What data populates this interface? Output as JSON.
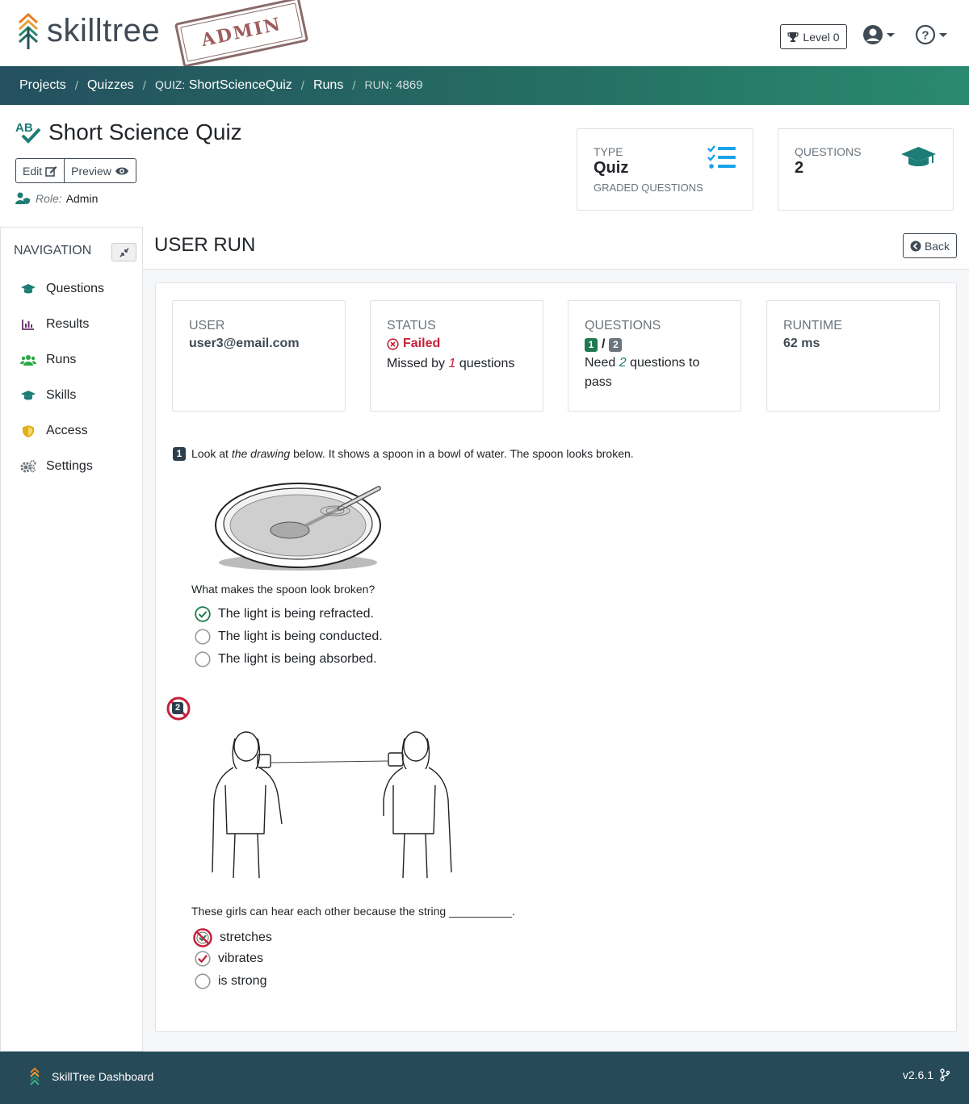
{
  "app": {
    "logo_text": "skilltree",
    "admin_stamp": "ADMIN",
    "level_label": "Level 0"
  },
  "breadcrumb": {
    "projects": "Projects",
    "quizzes": "Quizzes",
    "quiz_prefix": "QUIZ:",
    "quiz_name": "ShortScienceQuiz",
    "runs": "Runs",
    "run_prefix": "RUN:",
    "run_id": "4869"
  },
  "header": {
    "title": "Short Science Quiz",
    "edit_label": "Edit",
    "preview_label": "Preview",
    "role_label": "Role:",
    "role_value": "Admin",
    "type_card": {
      "label": "TYPE",
      "value": "Quiz",
      "sub": "GRADED QUESTIONS"
    },
    "questions_card": {
      "label": "QUESTIONS",
      "value": "2"
    }
  },
  "sidebar": {
    "heading": "NAVIGATION",
    "items": [
      {
        "label": "Questions",
        "icon": "graduation-cap-icon",
        "color": "#1d7c75"
      },
      {
        "label": "Results",
        "icon": "bar-chart-icon",
        "color": "#6b2f6b"
      },
      {
        "label": "Runs",
        "icon": "users-icon",
        "color": "#28a745"
      },
      {
        "label": "Skills",
        "icon": "graduation-cap-icon",
        "color": "#1d7c75"
      },
      {
        "label": "Access",
        "icon": "shield-icon",
        "color": "#e0b016"
      },
      {
        "label": "Settings",
        "icon": "gears-icon",
        "color": "#6c757d"
      }
    ]
  },
  "main": {
    "title": "USER RUN",
    "back_label": "Back",
    "user": {
      "label": "USER",
      "value": "user3@email.com"
    },
    "status": {
      "label": "STATUS",
      "value": "Failed",
      "missed_prefix": "Missed by",
      "missed_count": "1",
      "missed_suffix": "questions"
    },
    "questions": {
      "label": "QUESTIONS",
      "correct": "1",
      "separator": "/",
      "total": "2",
      "need_prefix": "Need",
      "need_count": "2",
      "need_suffix": "questions to pass"
    },
    "runtime": {
      "label": "RUNTIME",
      "value": "62 ms"
    }
  },
  "questions": [
    {
      "number": "1",
      "text_before": "Look at",
      "text_em": "the drawing",
      "text_after": "below. It shows a spoon in a bowl of water. The spoon looks broken.",
      "prompt": "What makes the spoon look broken?",
      "answers": [
        {
          "text": "The light is being refracted.",
          "state": "correct-selected"
        },
        {
          "text": "The light is being conducted.",
          "state": "unselected"
        },
        {
          "text": "The light is being absorbed.",
          "state": "unselected"
        }
      ]
    },
    {
      "number": "2",
      "prompt": "These girls can hear each other because the string __________.",
      "answers": [
        {
          "text": "stretches",
          "state": "wrong-selected"
        },
        {
          "text": "vibrates",
          "state": "correct-unselected"
        },
        {
          "text": "is strong",
          "state": "unselected"
        }
      ]
    }
  ],
  "footer": {
    "brand": "SkillTree Dashboard",
    "version": "v2.6.1"
  },
  "colors": {
    "brand_dark": "#264a57",
    "success": "#1e7a4e",
    "danger": "#c4213a",
    "accent": "#1aa3e8"
  }
}
